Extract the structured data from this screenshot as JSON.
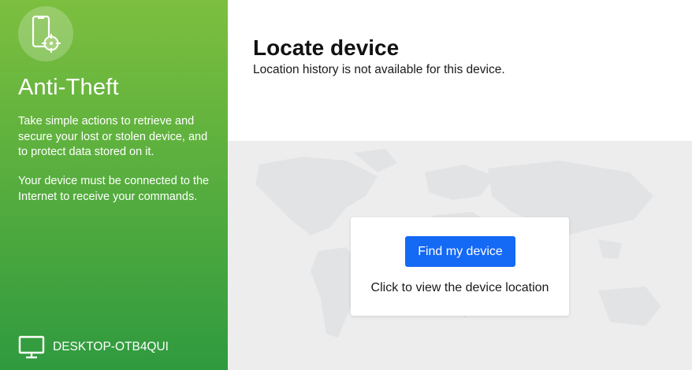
{
  "sidebar": {
    "app_icon": "phone-locate-icon",
    "title": "Anti-Theft",
    "description": "Take simple actions to retrieve and secure your lost or stolen device, and to protect data stored on it.",
    "note": "Your device must be connected to the Internet to receive your commands.",
    "device_icon": "monitor-icon",
    "device_name": "DESKTOP-OTB4QUI"
  },
  "main": {
    "title": "Locate device",
    "subtitle": "Location history is not available for this device.",
    "card": {
      "button_label": "Find my device",
      "caption": "Click to view the device location"
    }
  },
  "colors": {
    "sidebar_gradient_top": "#7dbf3f",
    "sidebar_gradient_bottom": "#2f9a3f",
    "button": "#1469f5",
    "map_background": "#ededee",
    "map_land": "#e2e3e5"
  }
}
